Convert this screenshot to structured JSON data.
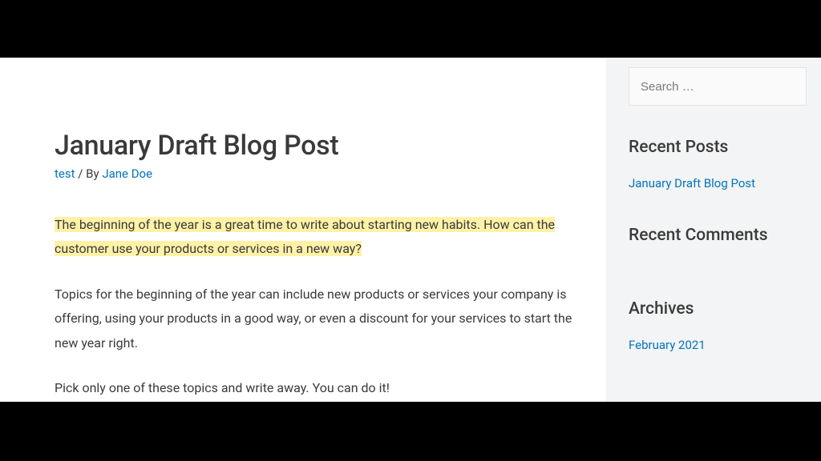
{
  "post": {
    "title": "January Draft Blog Post",
    "category": "test",
    "byline_separator": " / By ",
    "author": "Jane Doe",
    "para1": "The beginning of the year is a great time to write about starting new habits. How can the customer use your products or services in a new way?",
    "para2": "Topics for the beginning of the year can include new products or services your company is offering, using your products in a good way, or even a discount for your services to start the new year right.",
    "para3": "Pick only one of these topics and write away. You can do it!"
  },
  "sidebar": {
    "search_placeholder": "Search …",
    "recent_posts_heading": "Recent Posts",
    "recent_posts": {
      "0": "January Draft Blog Post"
    },
    "recent_comments_heading": "Recent Comments",
    "archives_heading": "Archives",
    "archives": {
      "0": "February 2021"
    }
  }
}
